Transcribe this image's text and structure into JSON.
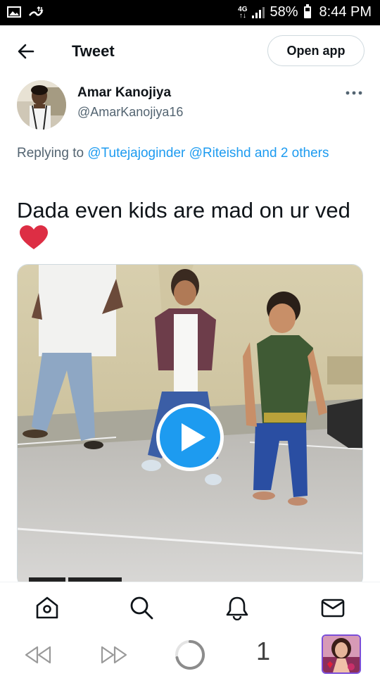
{
  "status_bar": {
    "network": "4G",
    "battery": "58%",
    "time": "8:44 PM"
  },
  "header": {
    "title": "Tweet",
    "open_app_label": "Open app"
  },
  "tweet": {
    "author_name": "Amar Kanojiya",
    "author_handle": "@AmarKanojiya16",
    "replying_prefix": "Replying to",
    "mentions": [
      "@Tutejajoginder",
      "@Riteishd",
      "and 2 others"
    ],
    "text": "Dada even kids are mad on ur ved",
    "emoji": "red-heart"
  },
  "bottom_nav": {
    "items": [
      "home-icon",
      "search-icon",
      "notifications-bell-icon",
      "messages-mail-icon"
    ]
  },
  "browser_toolbar": {
    "tab_count": "1"
  },
  "colors": {
    "accent": "#1d9bf0",
    "text": "#0f1419",
    "secondary": "#536471"
  }
}
